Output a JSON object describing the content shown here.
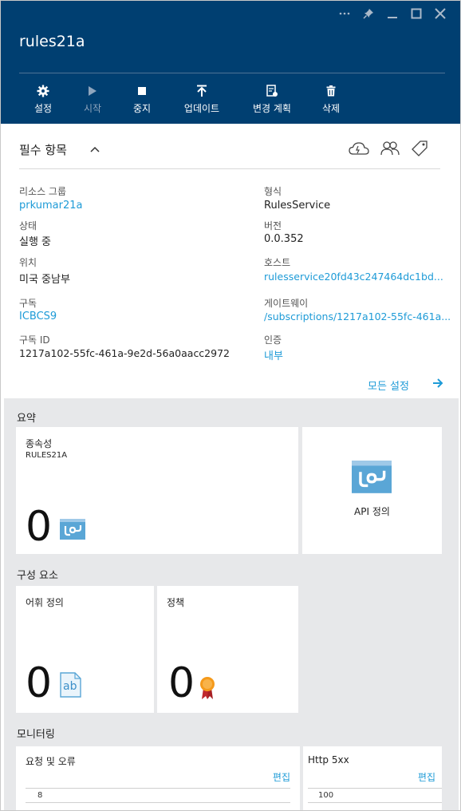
{
  "window": {
    "title": "rules21a",
    "controls": [
      "more-icon",
      "pin-icon",
      "minimize-icon",
      "maximize-icon",
      "close-icon"
    ]
  },
  "toolbar": {
    "settings_label": "설정",
    "start_label": "시작",
    "stop_label": "중지",
    "update_label": "업데이트",
    "change_plan_label": "변경 계획",
    "delete_label": "삭제"
  },
  "essentials": {
    "title": "필수 항목",
    "tools": [
      "deploy-cloud-icon",
      "users-icon",
      "tag-icon"
    ],
    "resource_group_label": "리소스 그룹",
    "resource_group_value": "prkumar21a",
    "status_label": "상태",
    "status_value": "실행 중",
    "location_label": "위치",
    "location_value": "미국 중남부",
    "subscription_label": "구독",
    "subscription_value": "ICBCS9",
    "subscription_id_label": "구독 ID",
    "subscription_id_value": "1217a102-55fc-461a-9e2d-56a0aacc2972",
    "type_label": "형식",
    "type_value": "RulesService",
    "version_label": "버전",
    "version_value": "0.0.352",
    "host_label": "호스트",
    "host_value": "rulesservice20fd43c247464dc1bd...",
    "gateway_label": "게이트웨이",
    "gateway_value": "/subscriptions/1217a102-55fc-461a...",
    "auth_label": "인증",
    "auth_value": "내부",
    "all_settings": "모든 설정"
  },
  "summary": {
    "section_title": "요약",
    "dependencies_title": "종속성",
    "dependencies_sub": "RULES21A",
    "dependencies_count": "0",
    "api_definition_label": "API 정의"
  },
  "components": {
    "section_title": "구성 요소",
    "vocabulary_title": "어휘 정의",
    "vocabulary_count": "0",
    "vocabulary_icon_text": "ab",
    "policy_title": "정책",
    "policy_count": "0"
  },
  "monitoring": {
    "section_title": "모니터링",
    "requests_title": "요청 및 오류",
    "requests_edit": "편집",
    "requests_axis_top": "8",
    "http5xx_title": "Http 5xx",
    "http5xx_edit": "편집",
    "http5xx_axis_top": "100"
  },
  "colors": {
    "header_bg": "#003f71",
    "link": "#1e9bd7",
    "panel_bg": "#e7e8ea",
    "api_icon": "#5aa6d6",
    "badge_orange": "#f59a1b",
    "badge_red": "#c0282d"
  }
}
